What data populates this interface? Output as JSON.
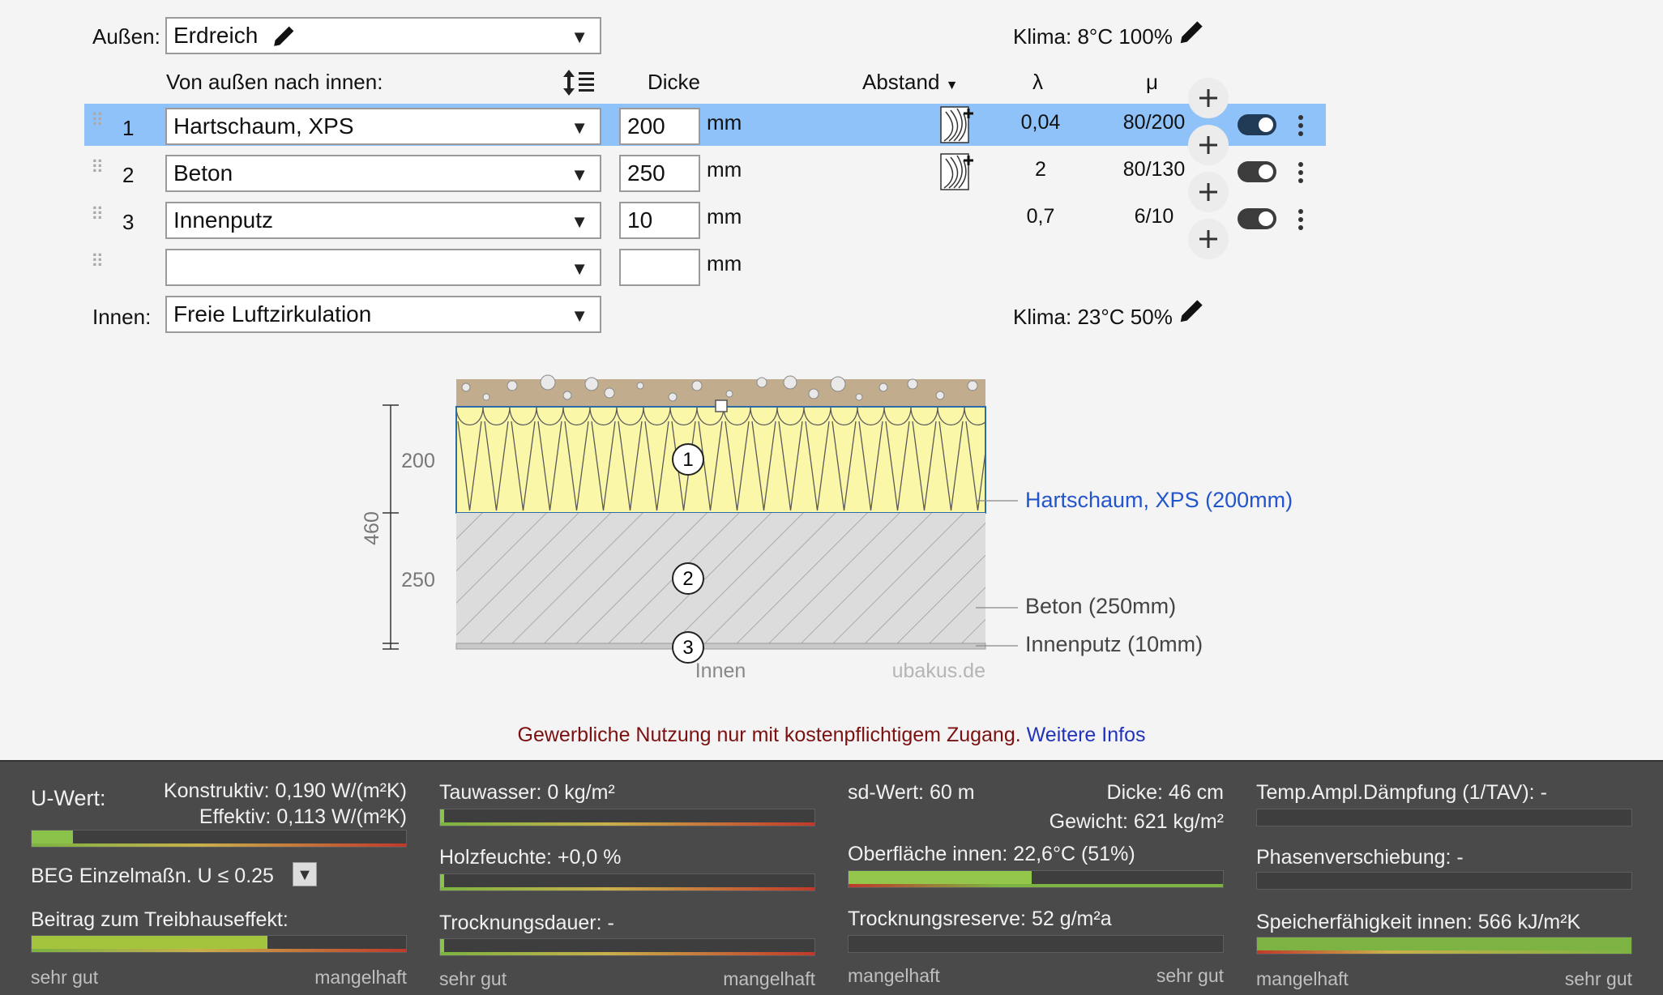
{
  "outer": {
    "label": "Außen:",
    "value": "Erdreich",
    "klima": "Klima: 8°C 100%"
  },
  "inner": {
    "label": "Innen:",
    "value": "Freie Luftzirkulation",
    "klima": "Klima: 23°C 50%"
  },
  "headers": {
    "order": "Von außen nach innen:",
    "thickness": "Dicke",
    "spacing": "Abstand",
    "lambda": "λ",
    "mu": "μ"
  },
  "unit": "mm",
  "layers": [
    {
      "num": "1",
      "material": "Hartschaum, XPS",
      "thickness": "200",
      "lambda": "0,04",
      "mu": "80/200",
      "selected": true
    },
    {
      "num": "2",
      "material": "Beton",
      "thickness": "250",
      "lambda": "2",
      "mu": "80/130",
      "selected": false
    },
    {
      "num": "3",
      "material": "Innenputz",
      "thickness": "10",
      "lambda": "0,7",
      "mu": "6/10",
      "selected": false
    },
    {
      "num": "",
      "material": "",
      "thickness": "",
      "lambda": "",
      "mu": "",
      "selected": false
    }
  ],
  "diagram": {
    "dim_total": "460",
    "dim_1": "200",
    "dim_2": "250",
    "callout_1": "Hartschaum, XPS (200mm)",
    "callout_2": "Beton (250mm)",
    "callout_3": "Innenputz (10mm)",
    "marker_1": "1",
    "marker_2": "2",
    "marker_3": "3",
    "inside_label": "Innen",
    "watermark": "ubakus.de"
  },
  "notice": {
    "text": "Gewerbliche Nutzung nur mit kostenpflichtigem Zugang.",
    "link": "Weitere Infos"
  },
  "results": {
    "uwert_label": "U-Wert:",
    "konstruktiv": "Konstruktiv: 0,190 W/(m²K)",
    "effektiv": "Effektiv: 0,113 W/(m²K)",
    "beg": "BEG Einzelmaßn. U ≤ 0.25",
    "treibhaus": "Beitrag zum Treibhauseffekt:",
    "tauwasser": "Tauwasser: 0 kg/m²",
    "holzfeuchte": "Holzfeuchte: +0,0 %",
    "trocknungsdauer": "Trocknungsdauer: -",
    "sd": "sd-Wert: 60 m",
    "dicke": "Dicke: 46 cm",
    "gewicht": "Gewicht: 621 kg/m²",
    "oberflaeche": "Oberfläche innen: 22,6°C (51%)",
    "trocknungsreserve": "Trocknungsreserve: 52 g/m²a",
    "tav": "Temp.Ampl.Dämpfung (1/TAV): -",
    "phase": "Phasenverschiebung: -",
    "speicher": "Speicherfähigkeit innen: 566 kJ/m²K",
    "good": "sehr gut",
    "bad": "mangelhaft"
  },
  "bar_levels": {
    "uwert": 0.11,
    "treibhaus": 0.63,
    "tauwasser": 0.01,
    "holzfeuchte": 0.01,
    "trocknungsdauer": 0.01,
    "oberflaeche": 0.49,
    "trocknungsreserve": 0.0,
    "tav": 0.0,
    "phase": 0.0,
    "speicher": 1.0
  },
  "colors": {
    "selected_row": "#8ec2f9",
    "xps": "#fbf7a8",
    "link": "#2255cc",
    "notice": "#7b1010"
  }
}
